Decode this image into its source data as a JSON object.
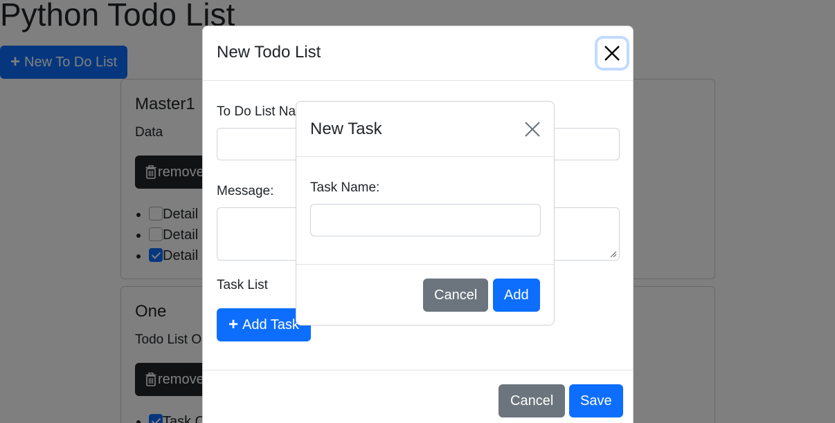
{
  "page": {
    "title": "Python Todo List",
    "new_list_button": "New To Do List"
  },
  "lists": [
    {
      "title": "Master1",
      "description": "Data",
      "remove_label": "remove",
      "tasks": [
        {
          "label": "Detail",
          "checked": false
        },
        {
          "label": "Detail",
          "checked": false
        },
        {
          "label": "Detail",
          "checked": true
        }
      ]
    },
    {
      "title": "One",
      "description": "Todo List O",
      "remove_label": "remove",
      "tasks": [
        {
          "label": "Task O",
          "checked": true
        }
      ]
    }
  ],
  "todo_modal": {
    "title": "New Todo List",
    "name_label": "To Do List Name:",
    "name_value": "",
    "message_label": "Message:",
    "message_value": "",
    "task_list_label": "Task List",
    "add_task_button": "Add Task",
    "cancel_button": "Cancel",
    "save_button": "Save"
  },
  "task_modal": {
    "title": "New Task",
    "task_name_label": "Task Name:",
    "task_name_value": "",
    "cancel_button": "Cancel",
    "add_button": "Add"
  },
  "colors": {
    "primary": "#0d6efd",
    "secondary": "#6c757d",
    "dark": "#212529",
    "backdrop": "rgba(0,0,0,0.5)"
  },
  "icons": {
    "plus": "plus-icon",
    "trash": "trash-icon",
    "close": "close-icon",
    "checkbox": "checkbox-icon"
  }
}
